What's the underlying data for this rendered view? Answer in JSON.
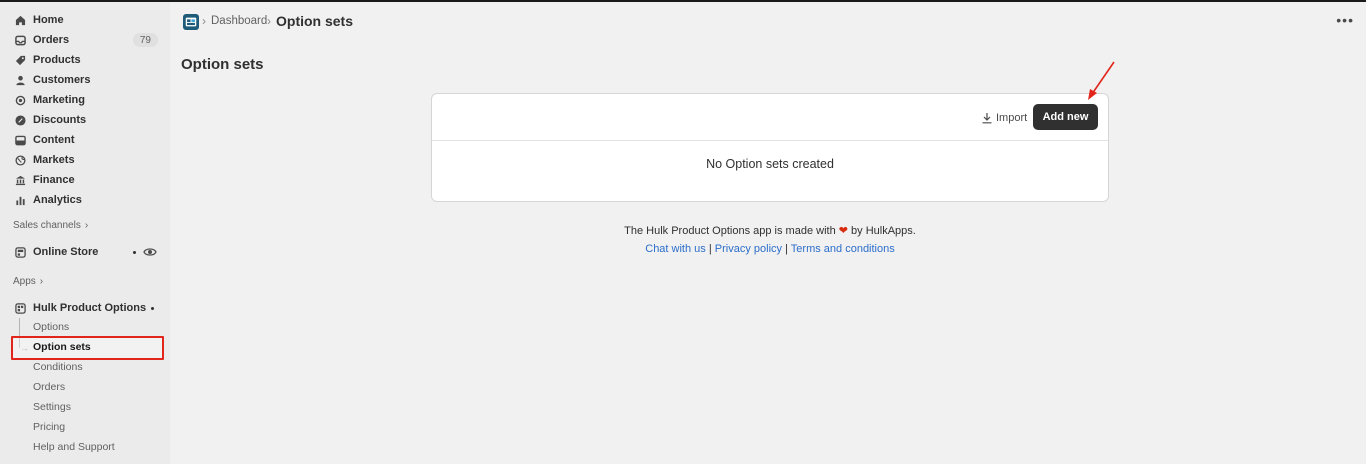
{
  "sidebar": {
    "main_nav": [
      {
        "label": "Home",
        "icon": "home-icon"
      },
      {
        "label": "Orders",
        "icon": "inbox-icon",
        "badge": "79"
      },
      {
        "label": "Products",
        "icon": "tag-icon"
      },
      {
        "label": "Customers",
        "icon": "person-icon"
      },
      {
        "label": "Marketing",
        "icon": "target-icon"
      },
      {
        "label": "Discounts",
        "icon": "discount-icon"
      },
      {
        "label": "Content",
        "icon": "content-icon"
      },
      {
        "label": "Markets",
        "icon": "globe-icon"
      },
      {
        "label": "Finance",
        "icon": "bank-icon"
      },
      {
        "label": "Analytics",
        "icon": "chart-icon"
      }
    ],
    "sales_channels_label": "Sales channels",
    "online_store_label": "Online Store",
    "apps_label": "Apps",
    "app_name": "Hulk Product Options",
    "app_sub_items": [
      {
        "label": "Options"
      },
      {
        "label": "Option sets",
        "active": true
      },
      {
        "label": "Conditions"
      },
      {
        "label": "Orders"
      },
      {
        "label": "Settings"
      },
      {
        "label": "Pricing"
      },
      {
        "label": "Help and Support"
      }
    ]
  },
  "header": {
    "breadcrumb_parent": "Dashboard",
    "breadcrumb_current": "Option sets"
  },
  "main": {
    "page_title": "Option sets",
    "import_label": "Import",
    "add_new_label": "Add new",
    "empty_state": "No Option sets created"
  },
  "footer": {
    "text_before": "The Hulk Product Options app is made with",
    "text_after": "by HulkApps.",
    "links": [
      "Chat with us",
      "Privacy policy",
      "Terms and conditions"
    ],
    "separator": "|"
  },
  "colors": {
    "accent_dark": "#303030",
    "link": "#2c6ecb",
    "highlight": "#e1251b",
    "heart": "#d72c0d"
  }
}
